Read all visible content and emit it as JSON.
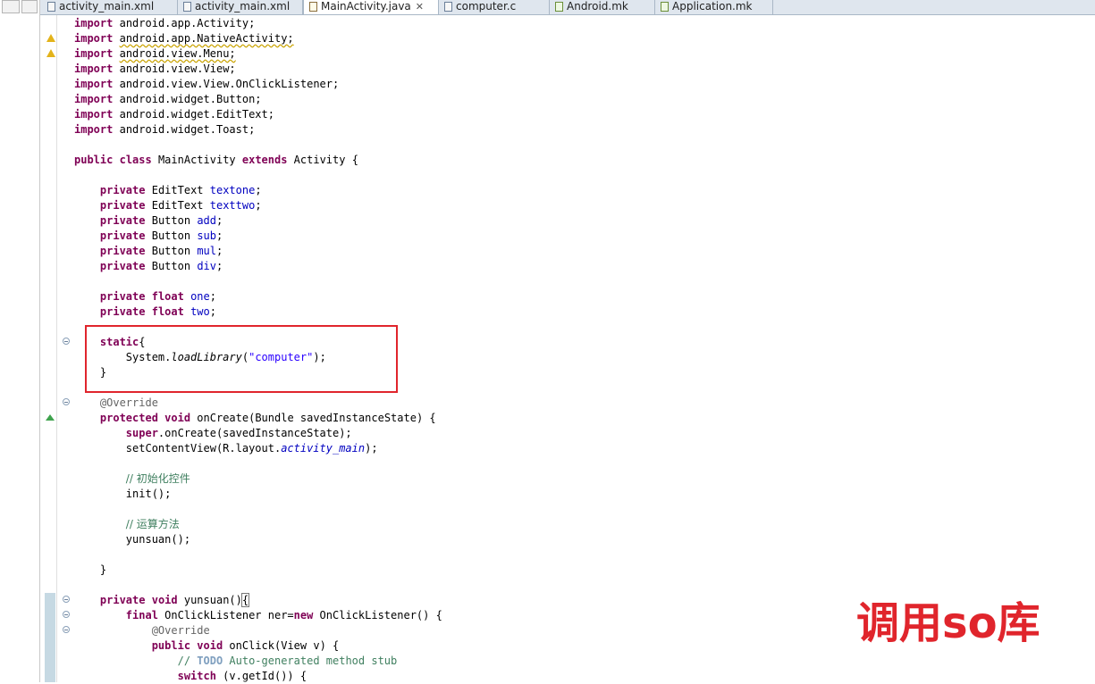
{
  "tabs": [
    {
      "label": "activity_main.xml",
      "icon": "xml-file-icon",
      "active": false
    },
    {
      "label": "activity_main.xml",
      "icon": "xml-file-icon",
      "active": false
    },
    {
      "label": "MainActivity.java",
      "icon": "java-file-icon",
      "active": true,
      "close": "✕"
    },
    {
      "label": "computer.c",
      "icon": "c-file-icon",
      "active": false
    },
    {
      "label": "Android.mk",
      "icon": "mk-file-icon",
      "active": false
    },
    {
      "label": "Application.mk",
      "icon": "mk-file-icon",
      "active": false
    }
  ],
  "code": {
    "imports": [
      {
        "kw": "import",
        "pkg": "android.app.Activity;",
        "warn": false
      },
      {
        "kw": "import",
        "pkg": "android.app.NativeActivity;",
        "warn": true
      },
      {
        "kw": "import",
        "pkg": "android.view.Menu;",
        "warn": true
      },
      {
        "kw": "import",
        "pkg": "android.view.View;",
        "warn": false
      },
      {
        "kw": "import",
        "pkg": "android.view.View.OnClickListener;",
        "warn": false
      },
      {
        "kw": "import",
        "pkg": "android.widget.Button;",
        "warn": false
      },
      {
        "kw": "import",
        "pkg": "android.widget.EditText;",
        "warn": false
      },
      {
        "kw": "import",
        "pkg": "android.widget.Toast;",
        "warn": false
      }
    ],
    "class_decl": {
      "kw1": "public",
      "kw2": "class",
      "name": " MainActivity ",
      "kw3": "extends",
      "rest": " Activity {"
    },
    "fields": [
      {
        "type": "EditText",
        "name": "textone"
      },
      {
        "type": "EditText",
        "name": "texttwo"
      },
      {
        "type": "Button",
        "name": "add"
      },
      {
        "type": "Button",
        "name": "sub"
      },
      {
        "type": "Button",
        "name": "mul"
      },
      {
        "type": "Button",
        "name": "div"
      }
    ],
    "float_fields": [
      {
        "name": "one"
      },
      {
        "name": "two"
      }
    ],
    "kw_private": "private",
    "kw_float": "float",
    "static_kw": "static",
    "static_open": "{",
    "load_prefix": "System.",
    "load_method": "loadLibrary",
    "load_arg": "\"computer\"",
    "load_suffix": ");",
    "close_brace": "}",
    "override": "@Override",
    "oncreate": {
      "kw1": "protected",
      "kw2": "void",
      "sig": " onCreate(Bundle savedInstanceState) {"
    },
    "super_kw": "super",
    "super_call": ".onCreate(savedInstanceState);",
    "setcontent_prefix": "setContentView(R.layout.",
    "setcontent_field": "activity_main",
    "setcontent_suffix": ");",
    "comment_init": "// 初始化控件",
    "init_call": "init();",
    "comment_calc": "// 运算方法",
    "yunsuan_call": "yunsuan();",
    "yunsuan_decl": {
      "kw1": "private",
      "kw2": "void",
      "sig": " yunsuan()",
      "brace": "{"
    },
    "listener": {
      "kw1": "final",
      "mid": " OnClickListener ner=",
      "kw2": "new",
      "rest": " OnClickListener() {"
    },
    "onclick": {
      "kw1": "public",
      "kw2": "void",
      "sig": " onClick(View v) {"
    },
    "todo": {
      "slashes": "// ",
      "tag": "TODO",
      "rest": " Auto-generated method stub"
    },
    "switch_line": {
      "kw": "switch",
      "rest": " (v.getId()) {"
    }
  },
  "overlay_label": "调用so库"
}
